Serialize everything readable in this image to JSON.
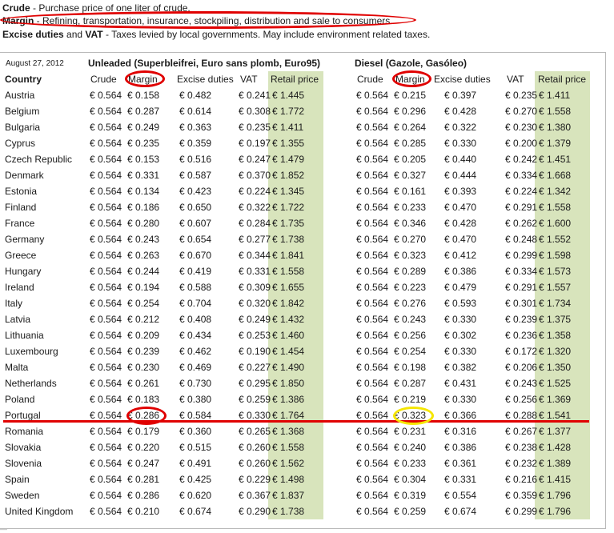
{
  "legend": {
    "crude_term": "Crude",
    "crude_desc": " - Purchase price of one liter of crude.",
    "margin_term": "Margin",
    "margin_desc": " - Refining, transportation, insurance, stockpiling, distribution and sale to consumers.",
    "excise_term": "Excise duties",
    "excise_and": " and ",
    "vat_term": "VAT",
    "excise_desc": " - Taxes levied by local governments. May include environment related taxes."
  },
  "date": "August 27, 2012",
  "unleaded_title": "Unleaded (Superbleifrei, Euro sans plomb, Euro95)",
  "diesel_title": "Diesel (Gazole, Gasóleo)",
  "headers": {
    "country": "Country",
    "crude": "Crude",
    "margin": "Margin",
    "excise": "Excise duties",
    "vat": "VAT",
    "retail": "Retail price"
  },
  "rows": [
    {
      "country": "Austria",
      "u": [
        "€ 0.564",
        "€ 0.158",
        "€ 0.482",
        "€ 0.241",
        "€ 1.445"
      ],
      "d": [
        "€ 0.564",
        "€ 0.215",
        "€ 0.397",
        "€ 0.235",
        "€ 1.411"
      ]
    },
    {
      "country": "Belgium",
      "u": [
        "€ 0.564",
        "€ 0.287",
        "€ 0.614",
        "€ 0.308",
        "€ 1.772"
      ],
      "d": [
        "€ 0.564",
        "€ 0.296",
        "€ 0.428",
        "€ 0.270",
        "€ 1.558"
      ]
    },
    {
      "country": "Bulgaria",
      "u": [
        "€ 0.564",
        "€ 0.249",
        "€ 0.363",
        "€ 0.235",
        "€ 1.411"
      ],
      "d": [
        "€ 0.564",
        "€ 0.264",
        "€ 0.322",
        "€ 0.230",
        "€ 1.380"
      ]
    },
    {
      "country": "Cyprus",
      "u": [
        "€ 0.564",
        "€ 0.235",
        "€ 0.359",
        "€ 0.197",
        "€ 1.355"
      ],
      "d": [
        "€ 0.564",
        "€ 0.285",
        "€ 0.330",
        "€ 0.200",
        "€ 1.379"
      ]
    },
    {
      "country": "Czech Republic",
      "u": [
        "€ 0.564",
        "€ 0.153",
        "€ 0.516",
        "€ 0.247",
        "€ 1.479"
      ],
      "d": [
        "€ 0.564",
        "€ 0.205",
        "€ 0.440",
        "€ 0.242",
        "€ 1.451"
      ]
    },
    {
      "country": "Denmark",
      "u": [
        "€ 0.564",
        "€ 0.331",
        "€ 0.587",
        "€ 0.370",
        "€ 1.852"
      ],
      "d": [
        "€ 0.564",
        "€ 0.327",
        "€ 0.444",
        "€ 0.334",
        "€ 1.668"
      ]
    },
    {
      "country": "Estonia",
      "u": [
        "€ 0.564",
        "€ 0.134",
        "€ 0.423",
        "€ 0.224",
        "€ 1.345"
      ],
      "d": [
        "€ 0.564",
        "€ 0.161",
        "€ 0.393",
        "€ 0.224",
        "€ 1.342"
      ]
    },
    {
      "country": "Finland",
      "u": [
        "€ 0.564",
        "€ 0.186",
        "€ 0.650",
        "€ 0.322",
        "€ 1.722"
      ],
      "d": [
        "€ 0.564",
        "€ 0.233",
        "€ 0.470",
        "€ 0.291",
        "€ 1.558"
      ]
    },
    {
      "country": "France",
      "u": [
        "€ 0.564",
        "€ 0.280",
        "€ 0.607",
        "€ 0.284",
        "€ 1.735"
      ],
      "d": [
        "€ 0.564",
        "€ 0.346",
        "€ 0.428",
        "€ 0.262",
        "€ 1.600"
      ]
    },
    {
      "country": "Germany",
      "u": [
        "€ 0.564",
        "€ 0.243",
        "€ 0.654",
        "€ 0.277",
        "€ 1.738"
      ],
      "d": [
        "€ 0.564",
        "€ 0.270",
        "€ 0.470",
        "€ 0.248",
        "€ 1.552"
      ]
    },
    {
      "country": "Greece",
      "u": [
        "€ 0.564",
        "€ 0.263",
        "€ 0.670",
        "€ 0.344",
        "€ 1.841"
      ],
      "d": [
        "€ 0.564",
        "€ 0.323",
        "€ 0.412",
        "€ 0.299",
        "€ 1.598"
      ]
    },
    {
      "country": "Hungary",
      "u": [
        "€ 0.564",
        "€ 0.244",
        "€ 0.419",
        "€ 0.331",
        "€ 1.558"
      ],
      "d": [
        "€ 0.564",
        "€ 0.289",
        "€ 0.386",
        "€ 0.334",
        "€ 1.573"
      ]
    },
    {
      "country": "Ireland",
      "u": [
        "€ 0.564",
        "€ 0.194",
        "€ 0.588",
        "€ 0.309",
        "€ 1.655"
      ],
      "d": [
        "€ 0.564",
        "€ 0.223",
        "€ 0.479",
        "€ 0.291",
        "€ 1.557"
      ]
    },
    {
      "country": "Italy",
      "u": [
        "€ 0.564",
        "€ 0.254",
        "€ 0.704",
        "€ 0.320",
        "€ 1.842"
      ],
      "d": [
        "€ 0.564",
        "€ 0.276",
        "€ 0.593",
        "€ 0.301",
        "€ 1.734"
      ]
    },
    {
      "country": "Latvia",
      "u": [
        "€ 0.564",
        "€ 0.212",
        "€ 0.408",
        "€ 0.249",
        "€ 1.432"
      ],
      "d": [
        "€ 0.564",
        "€ 0.243",
        "€ 0.330",
        "€ 0.239",
        "€ 1.375"
      ]
    },
    {
      "country": "Lithuania",
      "u": [
        "€ 0.564",
        "€ 0.209",
        "€ 0.434",
        "€ 0.253",
        "€ 1.460"
      ],
      "d": [
        "€ 0.564",
        "€ 0.256",
        "€ 0.302",
        "€ 0.236",
        "€ 1.358"
      ]
    },
    {
      "country": "Luxembourg",
      "u": [
        "€ 0.564",
        "€ 0.239",
        "€ 0.462",
        "€ 0.190",
        "€ 1.454"
      ],
      "d": [
        "€ 0.564",
        "€ 0.254",
        "€ 0.330",
        "€ 0.172",
        "€ 1.320"
      ]
    },
    {
      "country": "Malta",
      "u": [
        "€ 0.564",
        "€ 0.230",
        "€ 0.469",
        "€ 0.227",
        "€ 1.490"
      ],
      "d": [
        "€ 0.564",
        "€ 0.198",
        "€ 0.382",
        "€ 0.206",
        "€ 1.350"
      ]
    },
    {
      "country": "Netherlands",
      "u": [
        "€ 0.564",
        "€ 0.261",
        "€ 0.730",
        "€ 0.295",
        "€ 1.850"
      ],
      "d": [
        "€ 0.564",
        "€ 0.287",
        "€ 0.431",
        "€ 0.243",
        "€ 1.525"
      ]
    },
    {
      "country": "Poland",
      "u": [
        "€ 0.564",
        "€ 0.183",
        "€ 0.380",
        "€ 0.259",
        "€ 1.386"
      ],
      "d": [
        "€ 0.564",
        "€ 0.219",
        "€ 0.330",
        "€ 0.256",
        "€ 1.369"
      ]
    },
    {
      "country": "Portugal",
      "u": [
        "€ 0.564",
        "€ 0.286",
        "€ 0.584",
        "€ 0.330",
        "€ 1.764"
      ],
      "d": [
        "€ 0.564",
        "€ 0.323",
        "€ 0.366",
        "€ 0.288",
        "€ 1.541"
      ]
    },
    {
      "country": "Romania",
      "u": [
        "€ 0.564",
        "€ 0.179",
        "€ 0.360",
        "€ 0.265",
        "€ 1.368"
      ],
      "d": [
        "€ 0.564",
        "€ 0.231",
        "€ 0.316",
        "€ 0.267",
        "€ 1.377"
      ]
    },
    {
      "country": "Slovakia",
      "u": [
        "€ 0.564",
        "€ 0.220",
        "€ 0.515",
        "€ 0.260",
        "€ 1.558"
      ],
      "d": [
        "€ 0.564",
        "€ 0.240",
        "€ 0.386",
        "€ 0.238",
        "€ 1.428"
      ]
    },
    {
      "country": "Slovenia",
      "u": [
        "€ 0.564",
        "€ 0.247",
        "€ 0.491",
        "€ 0.260",
        "€ 1.562"
      ],
      "d": [
        "€ 0.564",
        "€ 0.233",
        "€ 0.361",
        "€ 0.232",
        "€ 1.389"
      ]
    },
    {
      "country": "Spain",
      "u": [
        "€ 0.564",
        "€ 0.281",
        "€ 0.425",
        "€ 0.229",
        "€ 1.498"
      ],
      "d": [
        "€ 0.564",
        "€ 0.304",
        "€ 0.331",
        "€ 0.216",
        "€ 1.415"
      ]
    },
    {
      "country": "Sweden",
      "u": [
        "€ 0.564",
        "€ 0.286",
        "€ 0.620",
        "€ 0.367",
        "€ 1.837"
      ],
      "d": [
        "€ 0.564",
        "€ 0.319",
        "€ 0.554",
        "€ 0.359",
        "€ 1.796"
      ]
    },
    {
      "country": "United Kingdom",
      "u": [
        "€ 0.564",
        "€ 0.210",
        "€ 0.674",
        "€ 0.290",
        "€ 1.738"
      ],
      "d": [
        "€ 0.564",
        "€ 0.259",
        "€ 0.674",
        "€ 0.299",
        "€ 1.796"
      ]
    }
  ],
  "colors": {
    "retail_bg": "#d8e4bc",
    "annotation_red": "#e00000",
    "annotation_yellow": "#f5e600"
  }
}
